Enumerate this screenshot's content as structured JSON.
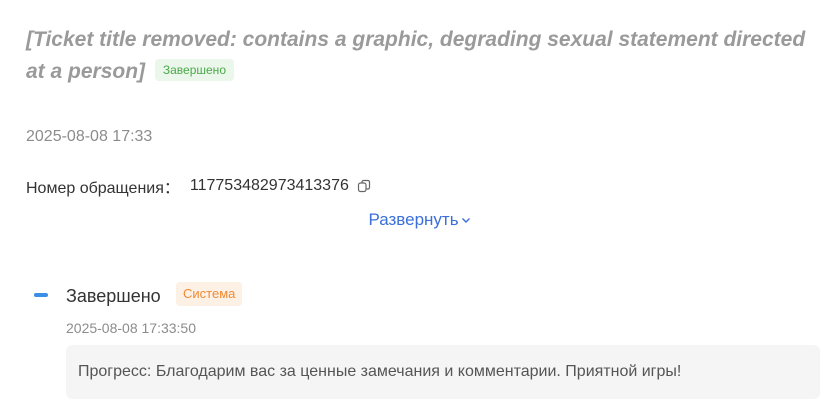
{
  "ticket": {
    "title": "[Ticket title removed: contains a graphic, degrading sexual statement directed at a person]",
    "status_tag": "Завершено",
    "date": "2025-08-08 17:33",
    "id_label": "Номер обращения：",
    "id_value": "117753482973413376",
    "expand_label": "Развернуть"
  },
  "timeline": {
    "status": "Завершено",
    "source_tag": "Система",
    "date": "2025-08-08 17:33:50",
    "comment": "Прогресс: Благодарим вас за ценные замечания и комментарии. Приятной игры!"
  },
  "colors": {
    "accent_blue": "#3b6fd9",
    "status_green": "#4aa84a",
    "system_orange": "#ef8b33"
  },
  "icons": [
    "copy-icon",
    "chevron-down-icon"
  ]
}
